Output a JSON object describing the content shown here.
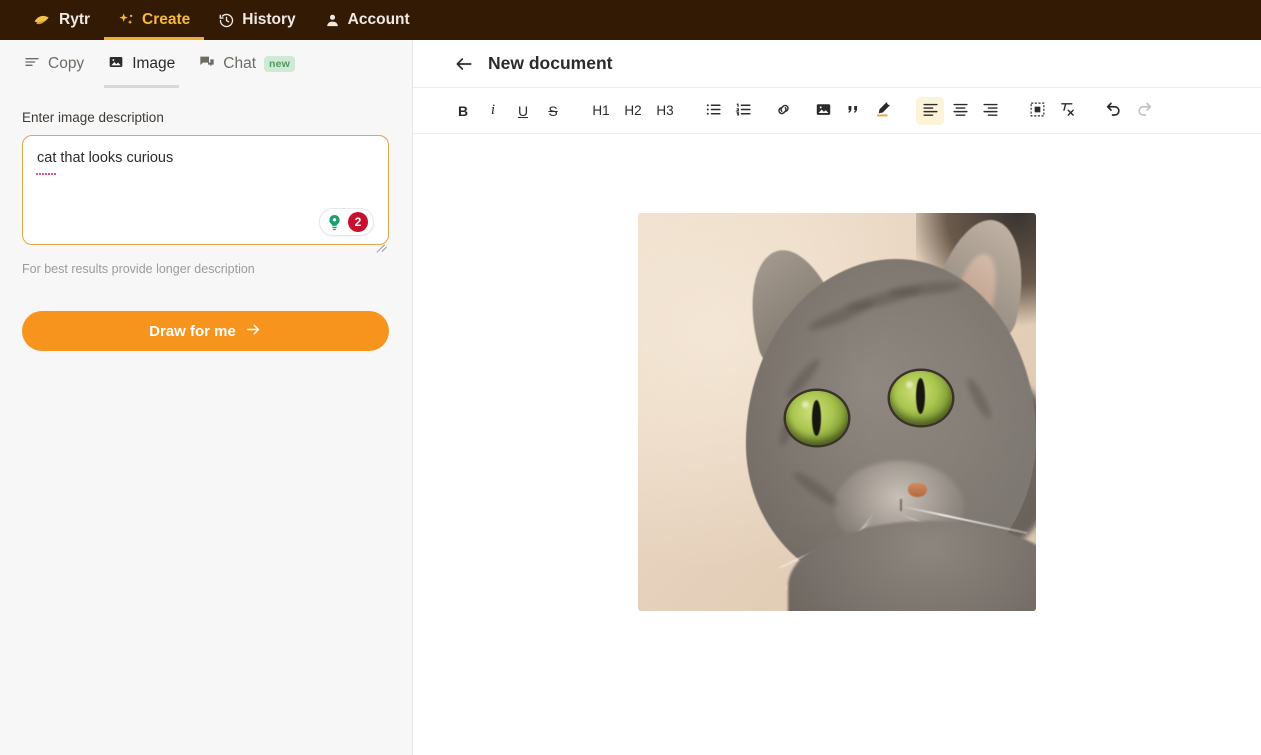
{
  "topnav": {
    "brand": "Rytr",
    "brand_icon": "rytr-logo-icon",
    "items": [
      {
        "label": "Create",
        "icon": "sparkle-icon",
        "active": true
      },
      {
        "label": "History",
        "icon": "history-clock-icon",
        "active": false
      },
      {
        "label": "Account",
        "icon": "person-icon",
        "active": false
      }
    ]
  },
  "sidebar": {
    "tabs": [
      {
        "label": "Copy",
        "icon": "lines-icon",
        "active": false,
        "badge": ""
      },
      {
        "label": "Image",
        "icon": "image-icon",
        "active": true,
        "badge": ""
      },
      {
        "label": "Chat",
        "icon": "chat-bubble-icon",
        "active": false,
        "badge": "new"
      }
    ],
    "form": {
      "label": "Enter image description",
      "value": "cat that looks curious",
      "placeholder": "Enter image description",
      "tip_icon": "lightbulb-icon",
      "tip_count": "2",
      "hint": "For best results provide longer description",
      "submit_label": "Draw for me",
      "submit_icon": "arrow-right-icon"
    }
  },
  "document": {
    "back_icon": "arrow-left-icon",
    "title": "New document",
    "toolbar": [
      {
        "name": "bold",
        "label": "B",
        "type": "text",
        "active": false,
        "disabled": false
      },
      {
        "name": "italic",
        "label": "i",
        "type": "text",
        "active": false,
        "disabled": false
      },
      {
        "name": "underline",
        "label": "U",
        "type": "text",
        "active": false,
        "disabled": false
      },
      {
        "name": "strikethrough",
        "label": "S",
        "type": "text",
        "active": false,
        "disabled": false
      },
      {
        "name": "heading-1",
        "label": "H1",
        "type": "text",
        "active": false,
        "disabled": false
      },
      {
        "name": "heading-2",
        "label": "H2",
        "type": "text",
        "active": false,
        "disabled": false
      },
      {
        "name": "heading-3",
        "label": "H3",
        "type": "text",
        "active": false,
        "disabled": false
      },
      {
        "name": "bullet-list",
        "label": "",
        "type": "icon",
        "active": false,
        "disabled": false
      },
      {
        "name": "numbered-list",
        "label": "",
        "type": "icon",
        "active": false,
        "disabled": false
      },
      {
        "name": "link",
        "label": "",
        "type": "icon",
        "active": false,
        "disabled": false
      },
      {
        "name": "image",
        "label": "",
        "type": "icon",
        "active": false,
        "disabled": false
      },
      {
        "name": "blockquote",
        "label": "",
        "type": "icon",
        "active": false,
        "disabled": false
      },
      {
        "name": "highlight",
        "label": "",
        "type": "icon",
        "active": false,
        "disabled": false
      },
      {
        "name": "align-left",
        "label": "",
        "type": "icon",
        "active": true,
        "disabled": false
      },
      {
        "name": "align-center",
        "label": "",
        "type": "icon",
        "active": false,
        "disabled": false
      },
      {
        "name": "align-right",
        "label": "",
        "type": "icon",
        "active": false,
        "disabled": false
      },
      {
        "name": "insert-frame",
        "label": "",
        "type": "icon",
        "active": false,
        "disabled": false
      },
      {
        "name": "clear-formatting",
        "label": "",
        "type": "icon",
        "active": false,
        "disabled": false
      },
      {
        "name": "undo",
        "label": "",
        "type": "icon",
        "active": false,
        "disabled": false
      },
      {
        "name": "redo",
        "label": "",
        "type": "icon",
        "active": false,
        "disabled": true
      }
    ],
    "content": {
      "image_alt": "grey tabby cat with green eyes looking curious"
    }
  },
  "colors": {
    "topnav_bg": "#331a05",
    "accent_gold": "#f0ad2e",
    "sidebar_bg": "#f7f7f7",
    "button_orange": "#f7941d",
    "badge_red": "#c8102e",
    "badge_green_bg": "#cfe9d4",
    "badge_green_fg": "#4f9a63",
    "textarea_border": "#e0a84a",
    "toolbar_active_bg": "#fdf3d9"
  }
}
